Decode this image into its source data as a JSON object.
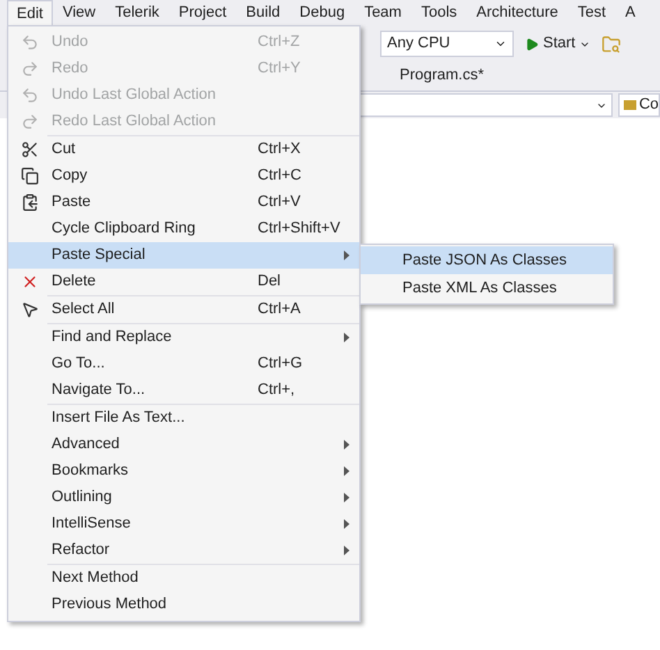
{
  "menu_bar": [
    {
      "label": "Edit",
      "selected": true
    },
    {
      "label": "View",
      "selected": false
    },
    {
      "label": "Telerik",
      "selected": false
    },
    {
      "label": "Project",
      "selected": false
    },
    {
      "label": "Build",
      "selected": false
    },
    {
      "label": "Debug",
      "selected": false
    },
    {
      "label": "Team",
      "selected": false
    },
    {
      "label": "Tools",
      "selected": false
    },
    {
      "label": "Architecture",
      "selected": false
    },
    {
      "label": "Test",
      "selected": false
    },
    {
      "label": "A",
      "selected": false
    }
  ],
  "toolbar": {
    "platform": "Any CPU",
    "start": "Start"
  },
  "document_tab": "Program.cs*",
  "nav_bar": {
    "right_label": "Co"
  },
  "edit_menu": [
    [
      {
        "label": "Undo",
        "shortcut": "Ctrl+Z",
        "disabled": true,
        "submenu": false,
        "selected": false
      },
      {
        "label": "Redo",
        "shortcut": "Ctrl+Y",
        "disabled": true,
        "submenu": false,
        "selected": false
      },
      {
        "label": "Undo Last Global Action",
        "disabled": true,
        "submenu": false,
        "selected": false
      },
      {
        "label": "Redo Last Global Action",
        "disabled": true,
        "submenu": false,
        "selected": false
      }
    ],
    [
      {
        "label": "Cut",
        "shortcut": "Ctrl+X",
        "disabled": false,
        "submenu": false,
        "selected": false
      },
      {
        "label": "Copy",
        "shortcut": "Ctrl+C",
        "disabled": false,
        "submenu": false,
        "selected": false
      },
      {
        "label": "Paste",
        "shortcut": "Ctrl+V",
        "disabled": false,
        "submenu": false,
        "selected": false
      },
      {
        "label": "Cycle Clipboard Ring",
        "shortcut": "Ctrl+Shift+V",
        "disabled": false,
        "submenu": false,
        "selected": false
      },
      {
        "label": "Paste Special",
        "disabled": false,
        "submenu": true,
        "selected": true
      },
      {
        "label": "Delete",
        "shortcut": "Del",
        "disabled": false,
        "submenu": false,
        "selected": false
      }
    ],
    [
      {
        "label": "Select All",
        "shortcut": "Ctrl+A",
        "disabled": false,
        "submenu": false,
        "selected": false
      }
    ],
    [
      {
        "label": "Find and Replace",
        "disabled": false,
        "submenu": true,
        "selected": false
      },
      {
        "label": "Go To...",
        "shortcut": "Ctrl+G",
        "disabled": false,
        "submenu": false,
        "selected": false
      },
      {
        "label": "Navigate To...",
        "shortcut": "Ctrl+,",
        "disabled": false,
        "submenu": false,
        "selected": false
      }
    ],
    [
      {
        "label": "Insert File As Text...",
        "disabled": false,
        "submenu": false,
        "selected": false
      },
      {
        "label": "Advanced",
        "disabled": false,
        "submenu": true,
        "selected": false
      },
      {
        "label": "Bookmarks",
        "disabled": false,
        "submenu": true,
        "selected": false
      },
      {
        "label": "Outlining",
        "disabled": false,
        "submenu": true,
        "selected": false
      },
      {
        "label": "IntelliSense",
        "disabled": false,
        "submenu": true,
        "selected": false
      },
      {
        "label": "Refactor",
        "disabled": false,
        "submenu": true,
        "selected": false
      }
    ],
    [
      {
        "label": "Next Method",
        "disabled": false,
        "submenu": false,
        "selected": false
      },
      {
        "label": "Previous Method",
        "disabled": false,
        "submenu": false,
        "selected": false
      }
    ]
  ],
  "paste_special_menu": [
    {
      "label": "Paste JSON As Classes",
      "selected": true
    },
    {
      "label": "Paste XML As Classes",
      "selected": false
    }
  ]
}
